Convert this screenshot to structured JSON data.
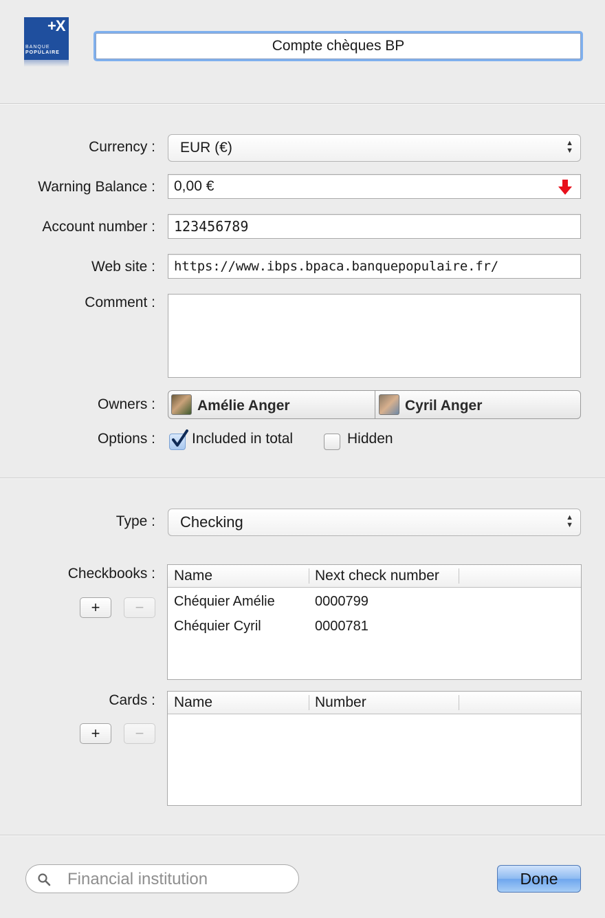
{
  "header": {
    "logo": {
      "icon": "banque-populaire-logo",
      "mark": "+X",
      "text_line1": "BANQUE",
      "text_line2": "POPULAIRE"
    },
    "account_name": "Compte chèques BP"
  },
  "form": {
    "currency": {
      "label": "Currency :",
      "value": "EUR (€)"
    },
    "warning_balance": {
      "label": "Warning Balance :",
      "value": "0,00 €",
      "indicator_color": "#e8101c"
    },
    "account_number": {
      "label": "Account number :",
      "value": "123456789"
    },
    "web_site": {
      "label": "Web site :",
      "value": "https://www.ibps.bpaca.banquepopulaire.fr/"
    },
    "comment": {
      "label": "Comment :",
      "value": ""
    },
    "owners": {
      "label": "Owners :",
      "items": [
        {
          "name": "Amélie Anger",
          "avatar": "avatar-photo"
        },
        {
          "name": "Cyril Anger",
          "avatar": "avatar-photo"
        }
      ]
    },
    "options": {
      "label": "Options :",
      "included_in_total": {
        "label": "Included in total",
        "checked": true
      },
      "hidden": {
        "label": "Hidden",
        "checked": false
      }
    }
  },
  "details": {
    "type": {
      "label": "Type :",
      "value": "Checking"
    },
    "checkbooks": {
      "label": "Checkbooks :",
      "columns": [
        "Name",
        "Next check number"
      ],
      "rows": [
        [
          "Chéquier Amélie",
          "0000799"
        ],
        [
          "Chéquier Cyril",
          "0000781"
        ]
      ],
      "add_label": "+",
      "remove_label": "−"
    },
    "cards": {
      "label": "Cards :",
      "columns": [
        "Name",
        "Number"
      ],
      "rows": [],
      "add_label": "+",
      "remove_label": "−"
    }
  },
  "footer": {
    "search_placeholder": "Financial institution",
    "done_label": "Done"
  },
  "colors": {
    "accent_focus": "#7fb0ee",
    "done_button": "#6ea6ee",
    "background": "#ececec"
  }
}
